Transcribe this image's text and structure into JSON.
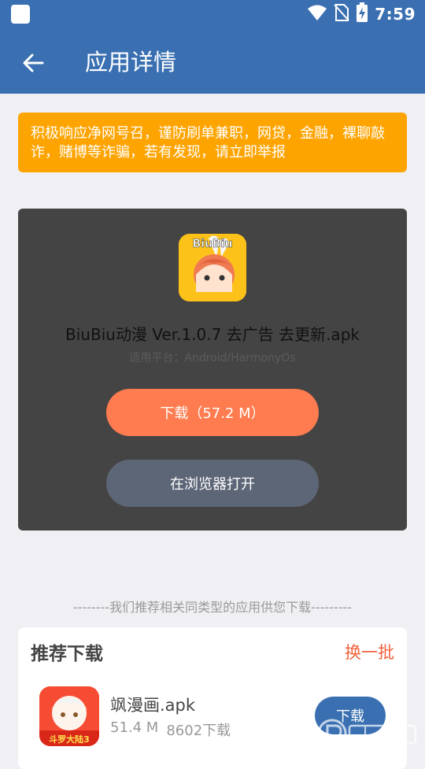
{
  "status_bar": {
    "time": "7:59"
  },
  "app_bar": {
    "title": "应用详情"
  },
  "warning": {
    "text": "积极响应净网号召，谨防刷单兼职，网贷，金融，裸聊敲诈，赌博等诈骗，若有发现，请立即举报"
  },
  "app": {
    "name": "BiuBiu动漫 Ver.1.0.7 去广告 去更新.apk",
    "platform": "适用平台：Android/HarmonyOs",
    "download_label": "下载（57.2 M）",
    "browser_label": "在浏览器打开",
    "icon_text": "BiuBiu"
  },
  "recommend": {
    "hint": "--------我们推荐相关同类型的应用供您下载---------",
    "title": "推荐下载",
    "refresh_label": "换一批",
    "items": [
      {
        "name": "飒漫画.apk",
        "size": "51.4 M",
        "downloads": "8602下载",
        "button_label": "下载",
        "icon_text": "斗罗大陆3"
      }
    ]
  },
  "colors": {
    "app_bar": "#3a70b2",
    "warning": "#fea401",
    "download_button": "#fe7c4f",
    "browser_button": "#5d6677",
    "refresh": "#f2603a"
  }
}
